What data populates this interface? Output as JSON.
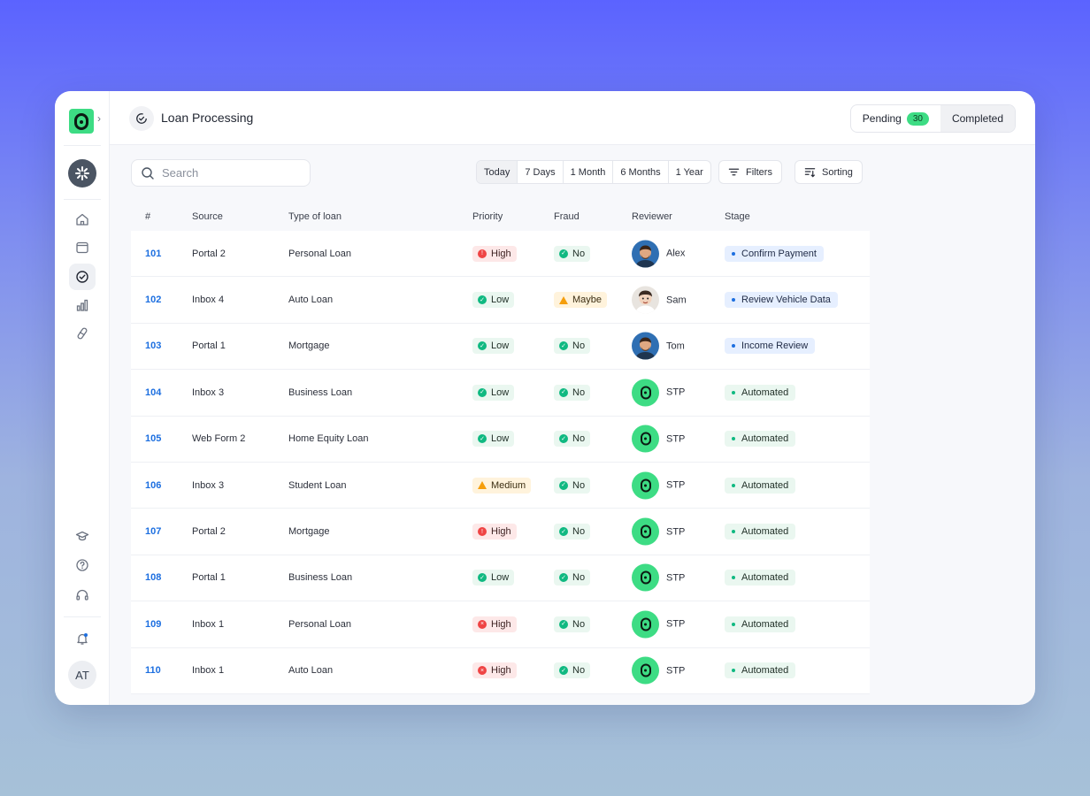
{
  "header": {
    "title": "Loan Processing",
    "tabs": [
      {
        "label": "Pending",
        "count": "30",
        "selected": false
      },
      {
        "label": "Completed",
        "selected": true
      }
    ]
  },
  "sidebar": {
    "icons": [
      "home-icon",
      "window-icon",
      "check-circle-icon",
      "bar-chart-icon",
      "pill-icon",
      "graduation-cap-icon",
      "help-icon",
      "headset-icon",
      "bell-icon"
    ],
    "active": "check-circle-icon",
    "user_initials": "AT"
  },
  "toolbar": {
    "search_placeholder": "Search",
    "ranges": [
      "Today",
      "7 Days",
      "1 Month",
      "6 Months",
      "1 Year"
    ],
    "selected_range": "Today",
    "filters_label": "Filters",
    "sorting_label": "Sorting"
  },
  "table": {
    "columns": [
      "#",
      "Source",
      "Type of loan",
      "Priority",
      "Fraud",
      "Reviewer",
      "Stage"
    ],
    "rows": [
      {
        "id": "101",
        "source": "Portal 2",
        "type": "Personal Loan",
        "priority": "High",
        "priority_level": "high",
        "fraud": "No",
        "reviewer": "Alex",
        "reviewer_kind": "person-a",
        "stage": "Confirm Payment",
        "stage_kind": "review"
      },
      {
        "id": "102",
        "source": "Inbox 4",
        "type": "Auto Loan",
        "priority": "Low",
        "priority_level": "low",
        "fraud": "Maybe",
        "reviewer": "Sam",
        "reviewer_kind": "person-b",
        "stage": "Review Vehicle Data",
        "stage_kind": "review"
      },
      {
        "id": "103",
        "source": "Portal 1",
        "type": "Mortgage",
        "priority": "Low",
        "priority_level": "low",
        "fraud": "No",
        "reviewer": "Tom",
        "reviewer_kind": "person-a",
        "stage": "Income Review",
        "stage_kind": "review"
      },
      {
        "id": "104",
        "source": "Inbox 3",
        "type": "Business Loan",
        "priority": "Low",
        "priority_level": "low",
        "fraud": "No",
        "reviewer": "STP",
        "reviewer_kind": "stp",
        "stage": "Automated",
        "stage_kind": "auto"
      },
      {
        "id": "105",
        "source": "Web Form 2",
        "type": "Home Equity Loan",
        "priority": "Low",
        "priority_level": "low",
        "fraud": "No",
        "reviewer": "STP",
        "reviewer_kind": "stp",
        "stage": "Automated",
        "stage_kind": "auto"
      },
      {
        "id": "106",
        "source": "Inbox 3",
        "type": "Student Loan",
        "priority": "Medium",
        "priority_level": "medium",
        "fraud": "No",
        "reviewer": "STP",
        "reviewer_kind": "stp",
        "stage": "Automated",
        "stage_kind": "auto"
      },
      {
        "id": "107",
        "source": "Portal 2",
        "type": "Mortgage",
        "priority": "High",
        "priority_level": "high",
        "fraud": "No",
        "reviewer": "STP",
        "reviewer_kind": "stp",
        "stage": "Automated",
        "stage_kind": "auto"
      },
      {
        "id": "108",
        "source": "Portal 1",
        "type": "Business Loan",
        "priority": "Low",
        "priority_level": "low",
        "fraud": "No",
        "reviewer": "STP",
        "reviewer_kind": "stp",
        "stage": "Automated",
        "stage_kind": "auto"
      },
      {
        "id": "109",
        "source": "Inbox 1",
        "type": "Personal Loan",
        "priority": "High",
        "priority_level": "high-x",
        "fraud": "No",
        "reviewer": "STP",
        "reviewer_kind": "stp",
        "stage": "Automated",
        "stage_kind": "auto"
      },
      {
        "id": "110",
        "source": "Inbox 1",
        "type": "Auto Loan",
        "priority": "High",
        "priority_level": "high-x",
        "fraud": "No",
        "reviewer": "STP",
        "reviewer_kind": "stp",
        "stage": "Automated",
        "stage_kind": "auto"
      }
    ]
  },
  "colors": {
    "brand_green": "#3ddc84",
    "link_blue": "#1d6fe0",
    "high_red": "#ef4444",
    "ok_green": "#10b981",
    "warn_amber": "#f59e0b"
  }
}
